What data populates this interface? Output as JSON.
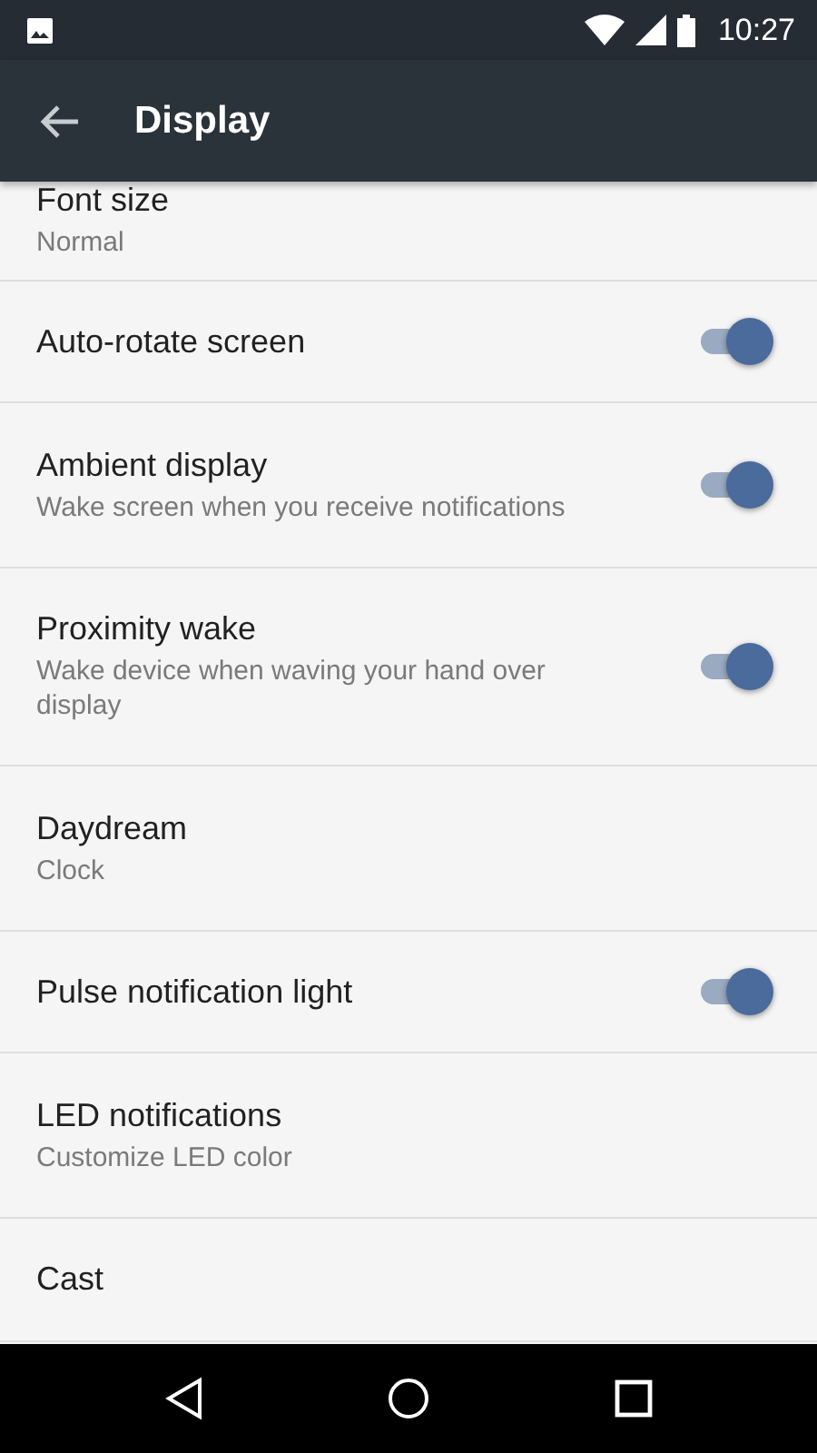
{
  "status_bar": {
    "time": "10:27"
  },
  "app_bar": {
    "title": "Display"
  },
  "settings": [
    {
      "kind": "text",
      "title": "Font size",
      "summary": "Normal"
    },
    {
      "kind": "switch",
      "title": "Auto-rotate screen",
      "on": true
    },
    {
      "kind": "switch",
      "title": "Ambient display",
      "summary": "Wake screen when you receive notifications",
      "on": true
    },
    {
      "kind": "switch",
      "title": "Proximity wake",
      "summary": "Wake device when waving your hand over display",
      "on": true
    },
    {
      "kind": "text",
      "title": "Daydream",
      "summary": "Clock"
    },
    {
      "kind": "switch",
      "title": "Pulse notification light",
      "on": true
    },
    {
      "kind": "text",
      "title": "LED notifications",
      "summary": "Customize LED color"
    },
    {
      "kind": "text",
      "title": "Cast"
    }
  ]
}
